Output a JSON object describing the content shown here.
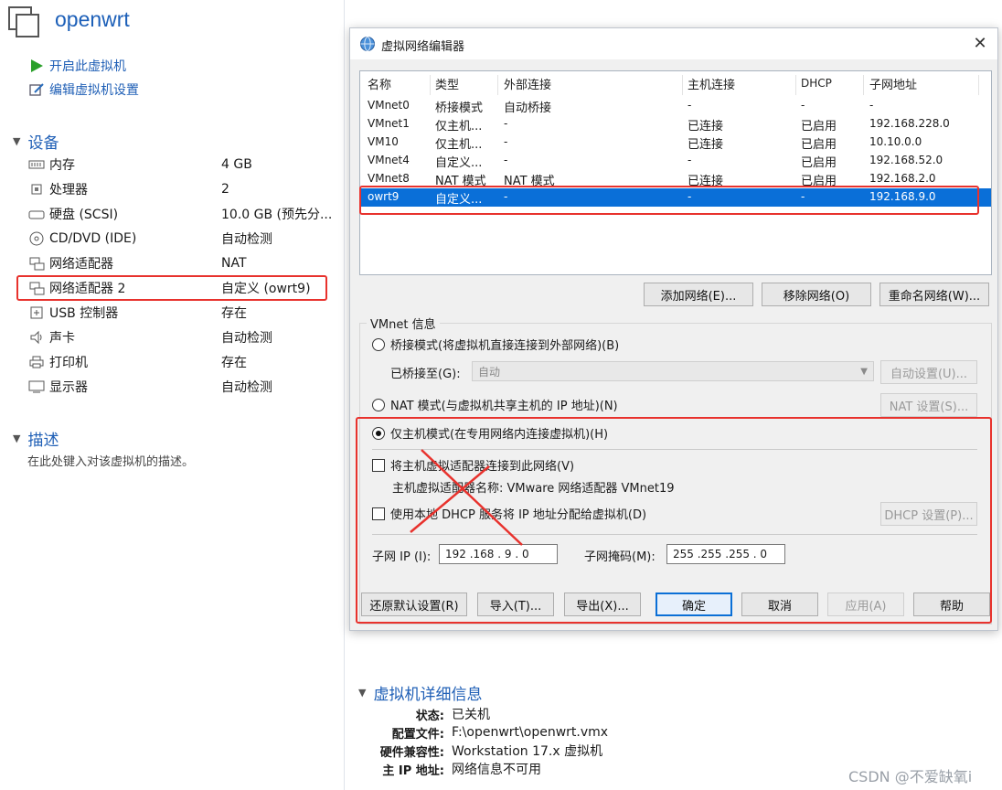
{
  "vm": {
    "title": "openwrt",
    "actions": [
      {
        "label": "开启此虚拟机",
        "icon": "play-icon"
      },
      {
        "label": "编辑虚拟机设置",
        "icon": "edit-settings-icon"
      }
    ],
    "devices_heading": "设备",
    "devices": [
      {
        "name": "内存",
        "value": "4 GB"
      },
      {
        "name": "处理器",
        "value": "2"
      },
      {
        "name": "硬盘 (SCSI)",
        "value": "10.0 GB (预先分..."
      },
      {
        "name": "CD/DVD (IDE)",
        "value": "自动检测"
      },
      {
        "name": "网络适配器",
        "value": "NAT"
      },
      {
        "name": "网络适配器 2",
        "value": "自定义 (owrt9)"
      },
      {
        "name": "USB 控制器",
        "value": "存在"
      },
      {
        "name": "声卡",
        "value": "自动检测"
      },
      {
        "name": "打印机",
        "value": "存在"
      },
      {
        "name": "显示器",
        "value": "自动检测"
      }
    ],
    "description_heading": "描述",
    "description_placeholder": "在此处键入对该虚拟机的描述。",
    "details_heading": "虚拟机详细信息",
    "details": [
      {
        "label": "状态:",
        "value": "已关机"
      },
      {
        "label": "配置文件:",
        "value": "F:\\openwrt\\openwrt.vmx"
      },
      {
        "label": "硬件兼容性:",
        "value": "Workstation 17.x 虚拟机"
      },
      {
        "label": "主 IP 地址:",
        "value": "网络信息不可用"
      }
    ]
  },
  "dialog": {
    "title": "虚拟网络编辑器",
    "close": "✕",
    "columns": [
      "名称",
      "类型",
      "外部连接",
      "主机连接",
      "DHCP",
      "子网地址"
    ],
    "rows": [
      [
        "VMnet0",
        "桥接模式",
        "自动桥接",
        "-",
        "-",
        "-"
      ],
      [
        "VMnet1",
        "仅主机...",
        "-",
        "已连接",
        "已启用",
        "192.168.228.0"
      ],
      [
        "VM10",
        "仅主机...",
        "-",
        "已连接",
        "已启用",
        "10.10.0.0"
      ],
      [
        "VMnet4",
        "自定义...",
        "-",
        "-",
        "已启用",
        "192.168.52.0"
      ],
      [
        "VMnet8",
        "NAT 模式",
        "NAT 模式",
        "已连接",
        "已启用",
        "192.168.2.0"
      ],
      [
        "owrt9",
        "自定义...",
        "-",
        "-",
        "-",
        "192.168.9.0"
      ]
    ],
    "selected_row": 5,
    "add_network": "添加网络(E)...",
    "remove_network": "移除网络(O)",
    "rename_network": "重命名网络(W)...",
    "group_label": "VMnet 信息",
    "bridged_option": "桥接模式(将虚拟机直接连接到外部网络)(B)",
    "bridged_to_label": "已桥接至(G):",
    "bridged_to_value": "自动",
    "auto_settings": "自动设置(U)...",
    "nat_option": "NAT 模式(与虚拟机共享主机的 IP 地址)(N)",
    "nat_settings": "NAT 设置(S)...",
    "hostonly_option": "仅主机模式(在专用网络内连接虚拟机)(H)",
    "connect_adapter": "将主机虚拟适配器连接到此网络(V)",
    "adapter_name": "主机虚拟适配器名称: VMware 网络适配器 VMnet19",
    "use_dhcp": "使用本地 DHCP 服务将 IP 地址分配给虚拟机(D)",
    "dhcp_settings": "DHCP 设置(P)...",
    "subnet_ip_label": "子网 IP (I):",
    "subnet_ip_value": "192 .168 . 9  . 0",
    "subnet_mask_label": "子网掩码(M):",
    "subnet_mask_value": "255 .255 .255 . 0",
    "restore_defaults": "还原默认设置(R)",
    "import": "导入(T)...",
    "export": "导出(X)...",
    "ok": "确定",
    "cancel": "取消",
    "apply": "应用(A)",
    "help": "帮助"
  },
  "watermark": "CSDN @不爱缺氧i",
  "colors": {
    "accent": "#1f5fb6",
    "highlight": "#e8322d",
    "selection": "#0a6fd8"
  }
}
